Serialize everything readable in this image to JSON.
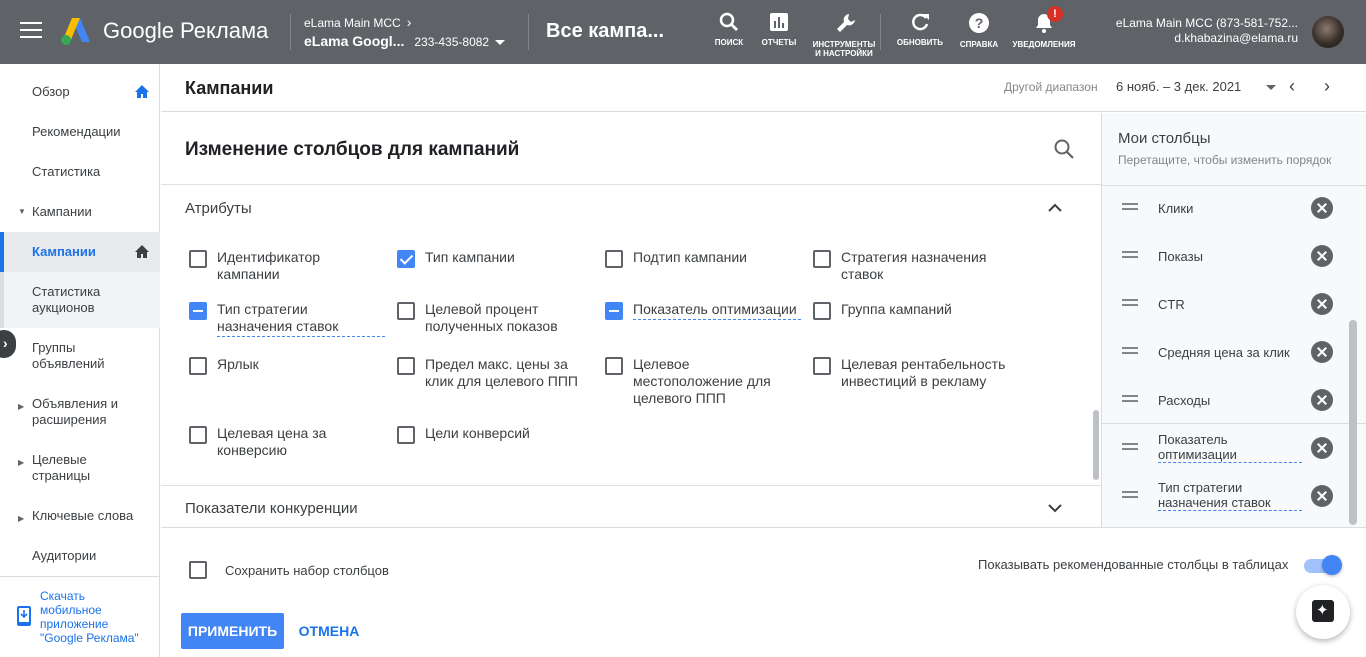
{
  "topbar": {
    "logo_text": "Google Реклама",
    "mcc_label": "eLama Main MCC",
    "mcc_chevron": "›",
    "account_name": "eLama Googl...",
    "account_id": "233-435-8082",
    "page_name": "Все кампа...",
    "tools": [
      {
        "icon": "search-icon",
        "label": "ПОИСК"
      },
      {
        "icon": "bar-chart-icon",
        "label": "ОТЧЕТЫ"
      },
      {
        "icon": "wrench-icon",
        "label": "ИНСТРУМЕНТЫ И НАСТРОЙКИ"
      },
      {
        "icon": "refresh-icon",
        "label": "ОБНОВИТЬ"
      },
      {
        "icon": "help-icon",
        "label": "СПРАВКА"
      },
      {
        "icon": "bell-icon",
        "label": "УВЕДОМЛЕНИЯ",
        "badge": "!"
      }
    ],
    "user_account": "eLama Main MCC (873-581-752...",
    "user_email": "d.khabazina@elama.ru"
  },
  "sidebar": {
    "items": [
      {
        "label": "Обзор"
      },
      {
        "label": "Рекомендации"
      },
      {
        "label": "Статистика"
      },
      {
        "label": "Кампании",
        "triangle": "▼"
      },
      {
        "label": "Кампании",
        "active": true
      },
      {
        "label": "Статистика аукционов"
      },
      {
        "label": "Группы объявлений",
        "triangle": "▶"
      },
      {
        "label": "Объявления и расширения",
        "triangle": "▶"
      },
      {
        "label": "Целевые страницы",
        "triangle": "▶"
      },
      {
        "label": "Ключевые слова",
        "triangle": "▶"
      },
      {
        "label": "Аудитории"
      }
    ],
    "collapse_glyph": "›",
    "app_promo": "Скачать мобильное приложение \"Google Реклама\""
  },
  "header": {
    "title": "Кампании",
    "range_label": "Другой диапазон",
    "range_value": "6 нояб. – 3 дек. 2021",
    "prev": "‹",
    "next": "›"
  },
  "dialog": {
    "title": "Изменение столбцов для кампаний",
    "section_attributes": "Атрибуты",
    "section_competition": "Показатели конкуренции",
    "options": [
      {
        "label": "Идентификатор кампании",
        "state": "unchecked"
      },
      {
        "label": "Тип кампании",
        "state": "checked"
      },
      {
        "label": "Подтип кампании",
        "state": "unchecked"
      },
      {
        "label": "Стратегия назначения ставок",
        "state": "unchecked"
      },
      {
        "label": "Тип стратегии назначения ставок",
        "state": "indeterminate"
      },
      {
        "label": "Целевой процент полученных показов",
        "state": "unchecked"
      },
      {
        "label": "Показатель оптимизации",
        "state": "indeterminate"
      },
      {
        "label": "Группа кампаний",
        "state": "unchecked"
      },
      {
        "label": "Ярлык",
        "state": "unchecked"
      },
      {
        "label": "Предел макс. цены за клик для целевого ППП",
        "state": "unchecked"
      },
      {
        "label": "Целевое местоположение для целевого ППП",
        "state": "unchecked"
      },
      {
        "label": "Целевая рентабельность инвестиций в рекламу",
        "state": "unchecked"
      },
      {
        "label": "Целевая цена за конверсию",
        "state": "unchecked"
      },
      {
        "label": "Цели конверсий",
        "state": "unchecked"
      }
    ]
  },
  "my_columns": {
    "title": "Мои столбцы",
    "subtitle": "Перетащите, чтобы изменить порядок",
    "items": [
      {
        "label": "Клики"
      },
      {
        "label": "Показы"
      },
      {
        "label": "CTR"
      },
      {
        "label": "Средняя цена за клик"
      },
      {
        "label": "Расходы"
      },
      {
        "label": "Показатель оптимизации"
      },
      {
        "label": "Тип стратегии назначения ставок"
      }
    ]
  },
  "footer": {
    "save_label": "Сохранить набор столбцов",
    "recommended_label": "Показывать рекомендованные столбцы в таблицах",
    "toggle_on": true,
    "apply": "ПРИМЕНИТЬ",
    "cancel": "ОТМЕНА"
  },
  "colors": {
    "topbar": "#5f6368",
    "accent": "#4285f4",
    "link": "#1a73e8"
  }
}
